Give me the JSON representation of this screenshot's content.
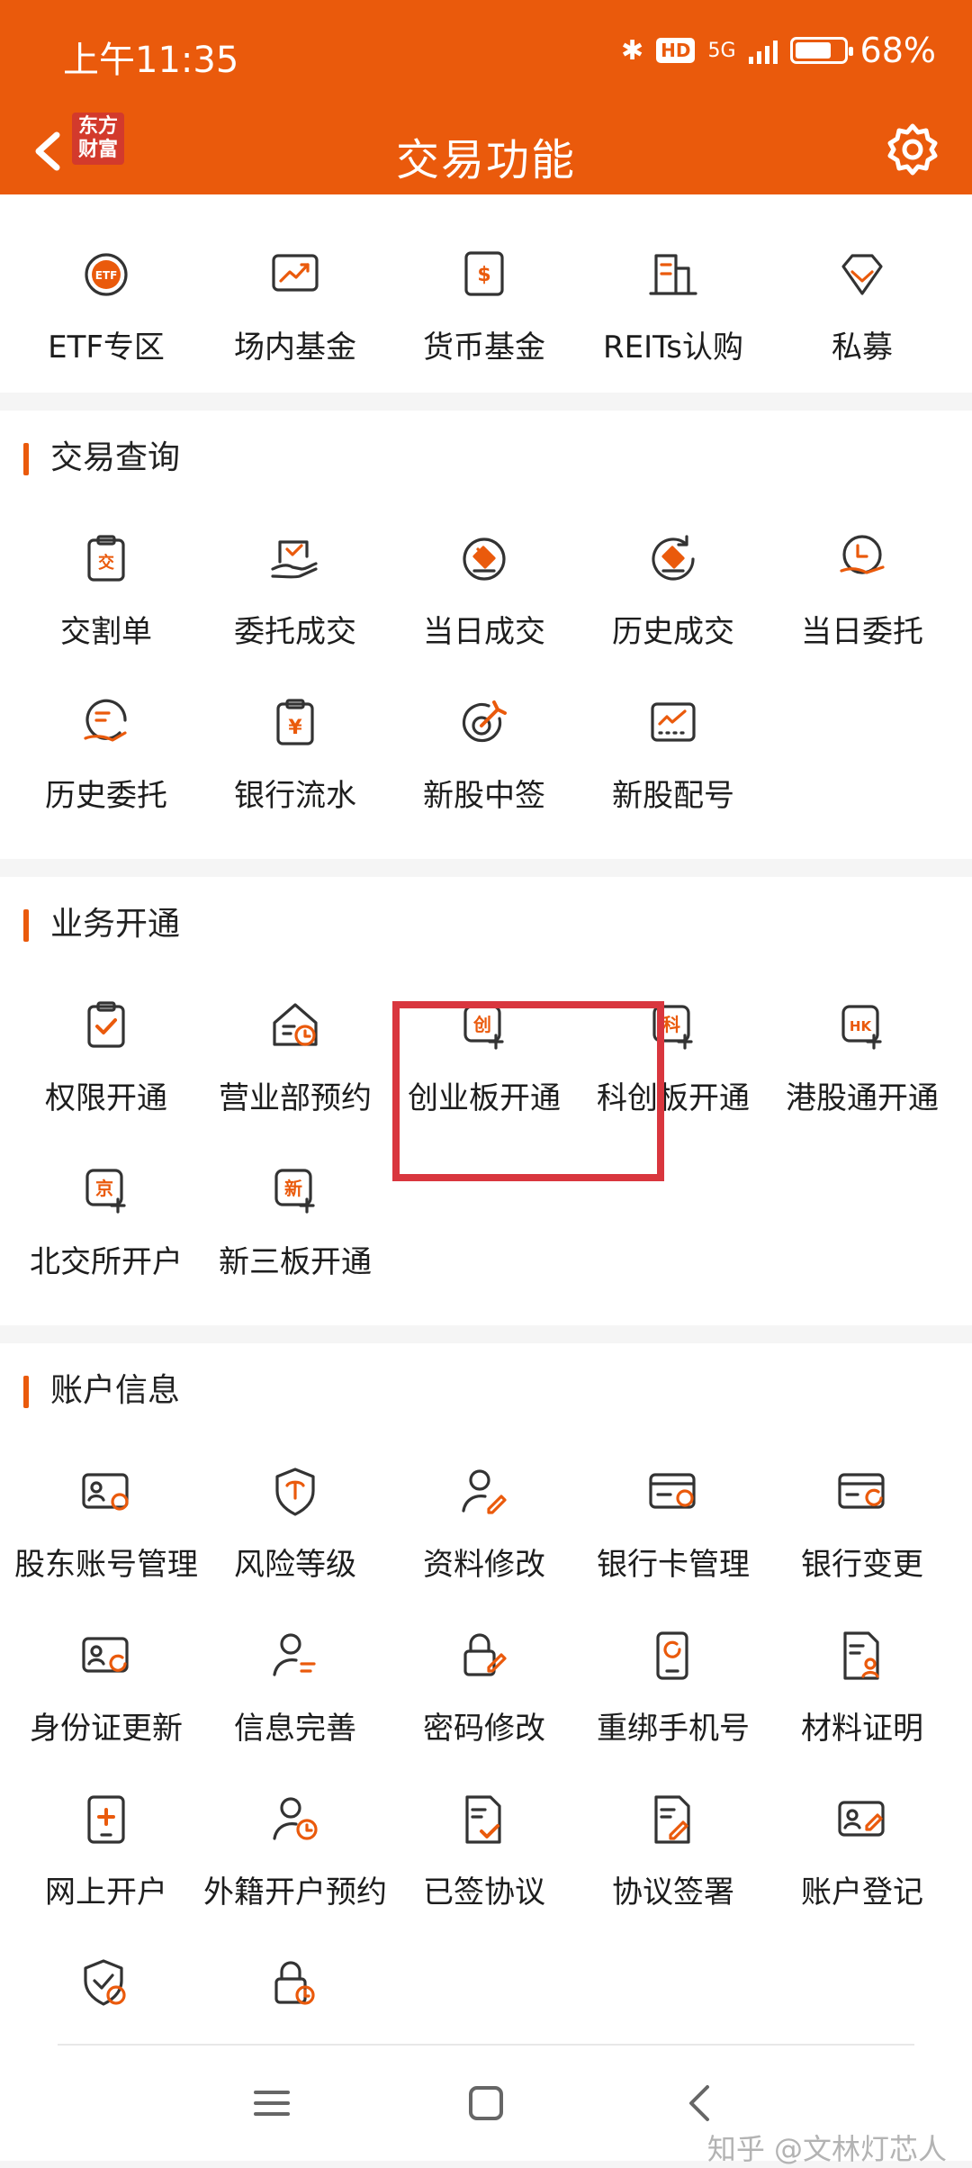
{
  "status_bar": {
    "time": "上午11:35",
    "network": "5G",
    "battery": "68%",
    "battery_level": 0.68
  },
  "header": {
    "back_icon": "back-chevron-icon",
    "logo_text": "东方财富",
    "title": "交易功能",
    "settings_icon": "gear-icon"
  },
  "top_row": [
    {
      "label": "ETF专区",
      "icon": "etf-icon"
    },
    {
      "label": "场内基金",
      "icon": "trend-chart-icon"
    },
    {
      "label": "货币基金",
      "icon": "dollar-icon"
    },
    {
      "label": "REITs认购",
      "icon": "building-icon"
    },
    {
      "label": "私募",
      "icon": "diamond-icon"
    }
  ],
  "sections": [
    {
      "title": "交易查询",
      "items": [
        {
          "label": "交割单",
          "icon": "clipboard-icon"
        },
        {
          "label": "委托成交",
          "icon": "hand-check-icon"
        },
        {
          "label": "当日成交",
          "icon": "hammer-circle-icon"
        },
        {
          "label": "历史成交",
          "icon": "history-hammer-icon"
        },
        {
          "label": "当日委托",
          "icon": "hand-clock-icon"
        },
        {
          "label": "历史委托",
          "icon": "history-hand-icon"
        },
        {
          "label": "银行流水",
          "icon": "yuan-clipboard-icon"
        },
        {
          "label": "新股中签",
          "icon": "target-icon"
        },
        {
          "label": "新股配号",
          "icon": "chart-frame-icon"
        }
      ]
    },
    {
      "title": "业务开通",
      "items": [
        {
          "label": "权限开通",
          "icon": "check-clipboard-icon"
        },
        {
          "label": "营业部预约",
          "icon": "house-clock-icon"
        },
        {
          "label": "创业板开通",
          "icon": "chuang-plus-icon"
        },
        {
          "label": "科创板开通",
          "icon": "ke-plus-icon"
        },
        {
          "label": "港股通开通",
          "icon": "hk-plus-icon"
        },
        {
          "label": "北交所开户",
          "icon": "jing-plus-icon"
        },
        {
          "label": "新三板开通",
          "icon": "xin-plus-icon"
        }
      ]
    },
    {
      "title": "账户信息",
      "items": [
        {
          "label": "股东账号管理",
          "icon": "id-card-icon"
        },
        {
          "label": "风险等级",
          "icon": "shield-icon"
        },
        {
          "label": "资料修改",
          "icon": "user-edit-icon"
        },
        {
          "label": "银行卡管理",
          "icon": "bank-card-icon"
        },
        {
          "label": "银行变更",
          "icon": "card-refresh-icon"
        },
        {
          "label": "身份证更新",
          "icon": "id-refresh-icon"
        },
        {
          "label": "信息完善",
          "icon": "user-list-icon"
        },
        {
          "label": "密码修改",
          "icon": "lock-edit-icon"
        },
        {
          "label": "重绑手机号",
          "icon": "phone-refresh-icon"
        },
        {
          "label": "材料证明",
          "icon": "doc-user-icon"
        },
        {
          "label": "网上开户",
          "icon": "tablet-plus-icon"
        },
        {
          "label": "外籍开户预约",
          "icon": "user-clock-icon"
        },
        {
          "label": "已签协议",
          "icon": "doc-check-icon"
        },
        {
          "label": "协议签署",
          "icon": "doc-pen-icon"
        },
        {
          "label": "账户登记",
          "icon": "card-pen-icon"
        },
        {
          "label": "",
          "icon": "shield-clock-icon"
        },
        {
          "label": "",
          "icon": "lock-clock-icon"
        }
      ]
    }
  ],
  "bottom_nav": [
    "menu-icon",
    "home-square-icon",
    "back-icon"
  ],
  "watermark": "知乎 @文林灯芯人",
  "colors": {
    "accent": "#ea5a0c",
    "highlight": "#d9363e"
  }
}
